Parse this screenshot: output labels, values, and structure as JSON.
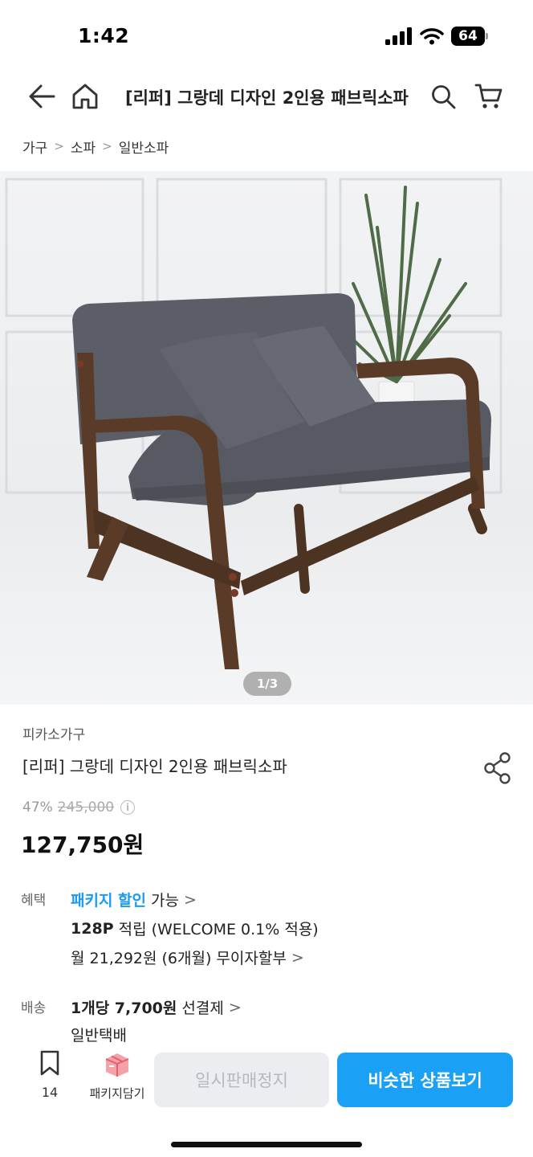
{
  "status": {
    "time": "1:42",
    "battery": "64"
  },
  "header": {
    "title": "[리퍼] 그랑데 디자인 2인용 패브릭소파"
  },
  "breadcrumb": [
    "가구",
    "소파",
    "일반소파"
  ],
  "image": {
    "counter": "1/3"
  },
  "product": {
    "seller": "피카소가구",
    "name": "[리퍼] 그랑데 디자인 2인용 패브릭소파",
    "discount": "47%",
    "original_price": "245,000",
    "sale_price": "127,750원"
  },
  "benefit": {
    "label": "혜택",
    "package_text": "패키지 할인",
    "package_suffix": "가능",
    "points": "128P",
    "points_suffix": "적립 (WELCOME 0.1% 적용)",
    "installment": "월 21,292원 (6개월) 무이자할부"
  },
  "delivery": {
    "label": "배송",
    "fee": "1개당 7,700원",
    "fee_suffix": "선결제",
    "type": "일반택배"
  },
  "bottom": {
    "bookmark_count": "14",
    "package_label": "패키지담기",
    "soldout_label": "일시판매정지",
    "similar_label": "비슷한 상품보기"
  },
  "colors": {
    "accent": "#1aa0f5",
    "sofa": "#55585f",
    "wood": "#5a3b28"
  }
}
